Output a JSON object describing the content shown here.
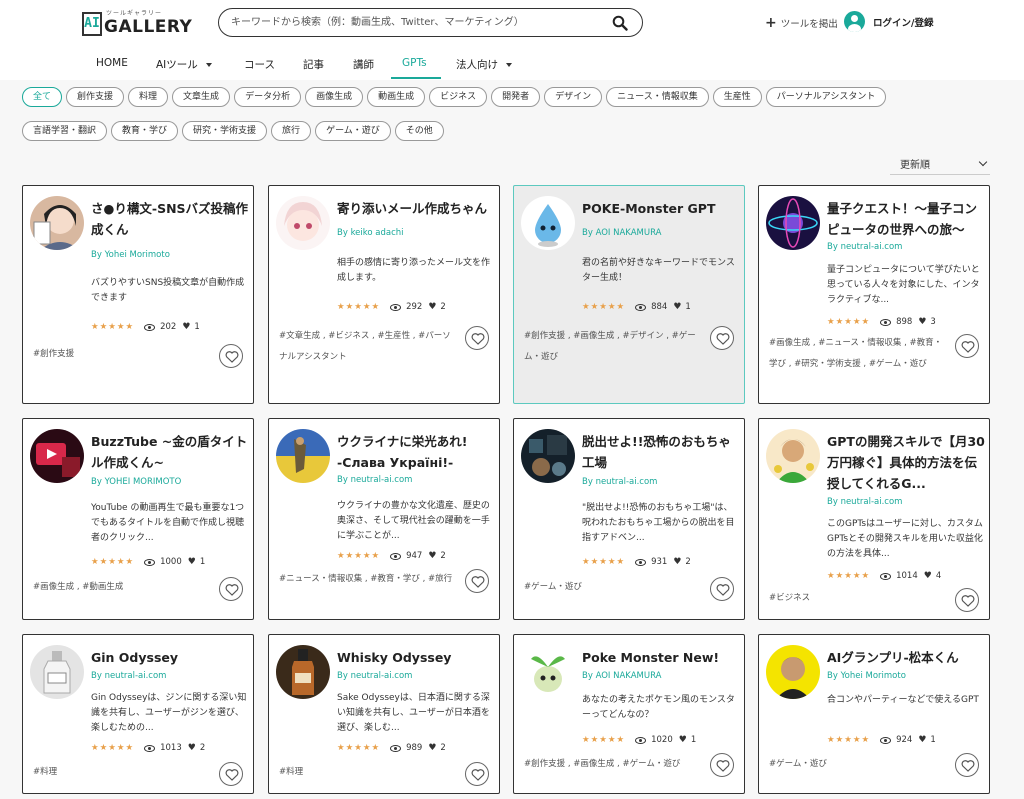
{
  "header": {
    "logo_mark": "AI",
    "logo_word": "GALLERY",
    "logo_sub": "ツールギャラリー",
    "search_placeholder": "キーワードから検索（例：動画生成、Twitter、マーケティング）",
    "submit_tool": "ツールを掲出",
    "login": "ログイン/登録"
  },
  "nav": [
    {
      "label": "HOME"
    },
    {
      "label": "AIツール"
    },
    {
      "label": "コース"
    },
    {
      "label": "記事"
    },
    {
      "label": "講師"
    },
    {
      "label": "GPTs"
    },
    {
      "label": "法人向け"
    }
  ],
  "filters": {
    "row1": [
      "全て",
      "創作支援",
      "料理",
      "文章生成",
      "データ分析",
      "画像生成",
      "動画生成",
      "ビジネス",
      "開発者",
      "デザイン",
      "ニュース・情報収集",
      "生産性",
      "パーソナルアシスタント"
    ],
    "row2": [
      "言語学習・翻訳",
      "教育・学び",
      "研究・学術支援",
      "旅行",
      "ゲーム・遊び",
      "その他"
    ]
  },
  "sort": {
    "label": "更新順"
  },
  "rating_stars": "★★★★★",
  "colors": {
    "accent": "#1aa99a",
    "star": "#e8a04a"
  },
  "cards": [
    {
      "title": "さ●り構文-SNSバズ投稿作成くん",
      "author": "By Yohei Morimoto",
      "desc": "バズりやすいSNS投稿文章が自動作成できます",
      "views": "202",
      "likes": "1",
      "tags": "#創作支援"
    },
    {
      "title": "寄り添いメール作成ちゃん",
      "author": "By keiko adachi",
      "desc": "相手の感情に寄り添ったメール文を作成します。",
      "views": "292",
      "likes": "2",
      "tags": "#文章生成 , #ビジネス , #生産性 , #パーソナルアシスタント"
    },
    {
      "title": "POKE-Monster GPT",
      "author": "By AOI NAKAMURA",
      "desc": "君の名前や好きなキーワードでモンスター生成！",
      "views": "884",
      "likes": "1",
      "tags": "#創作支援 , #画像生成 , #デザイン , #ゲーム・遊び"
    },
    {
      "title": "量子クエスト！〜量子コンピュータの世界への旅〜",
      "author": "By neutral-ai.com",
      "desc": "量子コンピュータについて学びたいと思っている人々を対象にした、インタラクティブな...",
      "views": "898",
      "likes": "3",
      "tags": "#画像生成 , #ニュース・情報収集 , #教育・学び , #研究・学術支援 , #ゲーム・遊び"
    },
    {
      "title": "BuzzTube ~金の盾タイトル作成くん~",
      "author": "By YOHEI MORIMOTO",
      "desc": "YouTube の動画再生で最も重要な1つでもあるタイトルを自動で作成し視聴者のクリック...",
      "views": "1000",
      "likes": "1",
      "tags": "#画像生成 , #動画生成"
    },
    {
      "title": "ウクライナに栄光あれ! -Слава Україні!-",
      "author": "By neutral-ai.com",
      "desc": "ウクライナの豊かな文化遺産、歴史の奥深さ、そして現代社会の躍動を一手に学ぶことが...",
      "views": "947",
      "likes": "2",
      "tags": "#ニュース・情報収集 , #教育・学び , #旅行"
    },
    {
      "title": "脱出せよ!!恐怖のおもちゃ工場",
      "author": "By neutral-ai.com",
      "desc": "\"脱出せよ!!恐怖のおもちゃ工場\"は、呪われたおもちゃ工場からの脱出を目指すアドベン...",
      "views": "931",
      "likes": "2",
      "tags": "#ゲーム・遊び"
    },
    {
      "title": "GPTの開発スキルで【月30万円稼ぐ】具体的方法を伝授してくれるG...",
      "author": "By neutral-ai.com",
      "desc": "このGPTsはユーザーに対し、カスタムGPTsとその開発スキルを用いた収益化の方法を具体...",
      "views": "1014",
      "likes": "4",
      "tags": "#ビジネス"
    },
    {
      "title": "Gin Odyssey",
      "author": "By neutral-ai.com",
      "desc": "Gin Odysseyは、ジンに関する深い知識を共有し、ユーザーがジンを選び、楽しむための...",
      "views": "1013",
      "likes": "2",
      "tags": "#料理"
    },
    {
      "title": "Whisky Odyssey",
      "author": "By neutral-ai.com",
      "desc": "Sake Odysseyは、日本酒に関する深い知識を共有し、ユーザーが日本酒を選び、楽しむ...",
      "views": "989",
      "likes": "2",
      "tags": "#料理"
    },
    {
      "title": "Poke Monster New!",
      "author": "By AOI NAKAMURA",
      "desc": "あなたの考えたポケモン風のモンスターってどんなの？",
      "views": "1020",
      "likes": "1",
      "tags": "#創作支援 , #画像生成 , #ゲーム・遊び"
    },
    {
      "title": "AIグランプリ-松本くん",
      "author": "By Yohei Morimoto",
      "desc": "合コンやパーティーなどで使えるGPT",
      "views": "924",
      "likes": "1",
      "tags": "#ゲーム・遊び"
    }
  ]
}
